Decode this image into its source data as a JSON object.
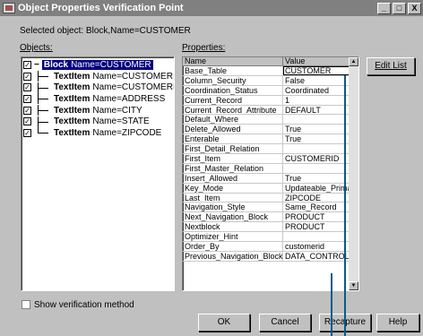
{
  "window": {
    "title": "Object Properties Verification Point",
    "controls": [
      "_",
      "□",
      "X"
    ]
  },
  "selected_object_text": "Selected object:  Block,Name=CUSTOMER",
  "objects_label": "Objects:",
  "properties_label": "Properties:",
  "tree": {
    "root": {
      "type": "Block",
      "name": "Name=CUSTOMER"
    },
    "children": [
      {
        "type": "TextItem",
        "name": "Name=CUSTOMERID"
      },
      {
        "type": "TextItem",
        "name": "Name=CUSTOMERNAM"
      },
      {
        "type": "TextItem",
        "name": "Name=ADDRESS"
      },
      {
        "type": "TextItem",
        "name": "Name=CITY"
      },
      {
        "type": "TextItem",
        "name": "Name=STATE"
      },
      {
        "type": "TextItem",
        "name": "Name=ZIPCODE"
      }
    ]
  },
  "properties": {
    "headers": {
      "name": "Name",
      "value": "Value"
    },
    "rows": [
      {
        "name": "Base_Table",
        "value": "CUSTOMER"
      },
      {
        "name": "Column_Security",
        "value": "False"
      },
      {
        "name": "Coordination_Status",
        "value": "Coordinated"
      },
      {
        "name": "Current_Record",
        "value": "1"
      },
      {
        "name": "Current_Record_Attribute",
        "value": "DEFAULT"
      },
      {
        "name": "Default_Where",
        "value": ""
      },
      {
        "name": "Delete_Allowed",
        "value": "True"
      },
      {
        "name": "Enterable",
        "value": "True"
      },
      {
        "name": "First_Detail_Relation",
        "value": ""
      },
      {
        "name": "First_Item",
        "value": "CUSTOMERID"
      },
      {
        "name": "First_Master_Relation",
        "value": ""
      },
      {
        "name": "Insert_Allowed",
        "value": "True"
      },
      {
        "name": "Key_Mode",
        "value": "Updateable_Primary"
      },
      {
        "name": "Last_Item",
        "value": "ZIPCODE"
      },
      {
        "name": "Navigation_Style",
        "value": "Same_Record"
      },
      {
        "name": "Next_Navigation_Block",
        "value": "PRODUCT"
      },
      {
        "name": "Nextblock",
        "value": "PRODUCT"
      },
      {
        "name": "Optimizer_Hint",
        "value": ""
      },
      {
        "name": "Order_By",
        "value": "customerid"
      },
      {
        "name": "Previous_Navigation_Block",
        "value": "DATA_CONTROL"
      }
    ]
  },
  "buttons": {
    "edit_list": "Edit List",
    "ok": "OK",
    "cancel": "Cancel",
    "recapture": "Recapture",
    "help": "Help"
  },
  "show_verification_label": "Show verification method"
}
